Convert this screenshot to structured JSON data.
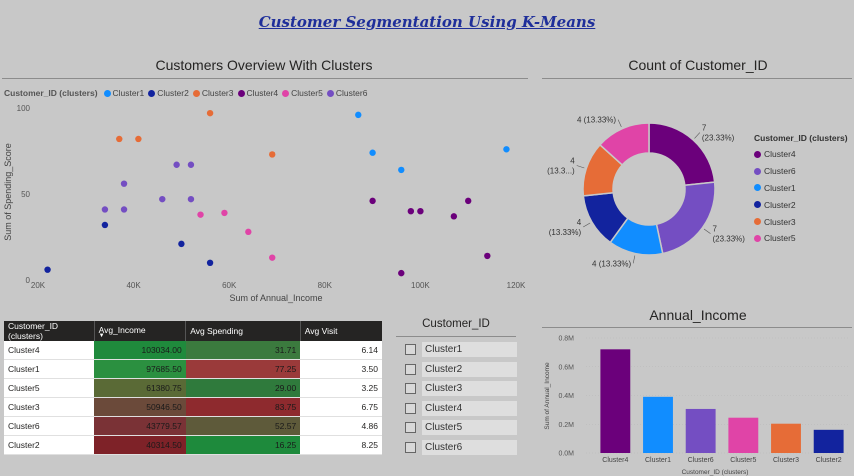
{
  "page": {
    "title": "Customer Segmentation Using K-Means"
  },
  "colors": {
    "Cluster1": "#118dff",
    "Cluster2": "#12239e",
    "Cluster3": "#e66c37",
    "Cluster4": "#6b007b",
    "Cluster5": "#e044a7",
    "Cluster6": "#744ec2"
  },
  "scatter": {
    "title": "Customers Overview With Clusters",
    "legend_title": "Customer_ID (clusters)",
    "legend_items": [
      "Cluster1",
      "Cluster2",
      "Cluster3",
      "Cluster4",
      "Cluster5",
      "Cluster6"
    ],
    "xlabel": "Sum of Annual_Income",
    "ylabel": "Sum of Spending_Score",
    "x_ticks": [
      "20K",
      "40K",
      "60K",
      "80K",
      "100K",
      "120K"
    ],
    "y_ticks": [
      "0",
      "50",
      "100"
    ]
  },
  "donut": {
    "title": "Count of Customer_ID",
    "legend_title": "Customer_ID (clusters)",
    "legend_items": [
      "Cluster4",
      "Cluster6",
      "Cluster1",
      "Cluster2",
      "Cluster3",
      "Cluster5"
    ],
    "labels": [
      "7\n(23.33%)",
      "7\n(23.33%)",
      "4 (13.33%)",
      "4\n(13.33%)",
      "4\n(13.3...)",
      "4 (13.33%)"
    ]
  },
  "table": {
    "headers": [
      "Customer_ID (clusters)",
      "Avg_Income",
      "Avg Spending",
      "Avg Visit"
    ],
    "rows": [
      {
        "cluster": "Cluster4",
        "income": "103034.00",
        "spending": "31.71",
        "visit": "6.14"
      },
      {
        "cluster": "Cluster1",
        "income": "97685.50",
        "spending": "77.25",
        "visit": "3.50"
      },
      {
        "cluster": "Cluster5",
        "income": "61380.75",
        "spending": "29.00",
        "visit": "3.25"
      },
      {
        "cluster": "Cluster3",
        "income": "50946.50",
        "spending": "83.75",
        "visit": "6.75"
      },
      {
        "cluster": "Cluster6",
        "income": "43779.57",
        "spending": "52.57",
        "visit": "4.86"
      },
      {
        "cluster": "Cluster2",
        "income": "40314.50",
        "spending": "16.25",
        "visit": "8.25"
      }
    ]
  },
  "slicer": {
    "title": "Customer_ID",
    "items": [
      "Cluster1",
      "Cluster2",
      "Cluster3",
      "Cluster4",
      "Cluster5",
      "Cluster6"
    ]
  },
  "chart_data": [
    {
      "type": "scatter",
      "title": "Customers Overview With Clusters",
      "xlabel": "Sum of Annual_Income",
      "ylabel": "Sum of Spending_Score",
      "xlim": [
        20000,
        120000
      ],
      "ylim": [
        0,
        100
      ],
      "legend": "top",
      "series": [
        {
          "name": "Cluster1",
          "points": [
            [
              87000,
              96
            ],
            [
              118000,
              76
            ],
            [
              90000,
              74
            ],
            [
              96000,
              64
            ]
          ]
        },
        {
          "name": "Cluster2",
          "points": [
            [
              22000,
              6
            ],
            [
              34000,
              32
            ],
            [
              50000,
              21
            ],
            [
              56000,
              10
            ]
          ]
        },
        {
          "name": "Cluster3",
          "points": [
            [
              37000,
              82
            ],
            [
              41000,
              82
            ],
            [
              56000,
              97
            ],
            [
              69000,
              73
            ]
          ]
        },
        {
          "name": "Cluster4",
          "points": [
            [
              90000,
              46
            ],
            [
              98000,
              40
            ],
            [
              100000,
              40
            ],
            [
              107000,
              37
            ],
            [
              110000,
              46
            ],
            [
              114000,
              14
            ],
            [
              96000,
              4
            ]
          ]
        },
        {
          "name": "Cluster5",
          "points": [
            [
              54000,
              38
            ],
            [
              59000,
              39
            ],
            [
              64000,
              28
            ],
            [
              69000,
              13
            ]
          ]
        },
        {
          "name": "Cluster6",
          "points": [
            [
              34000,
              41
            ],
            [
              38000,
              56
            ],
            [
              38000,
              41
            ],
            [
              46000,
              47
            ],
            [
              49000,
              67
            ],
            [
              52000,
              67
            ],
            [
              52000,
              47
            ]
          ]
        }
      ]
    },
    {
      "type": "pie",
      "title": "Count of Customer_ID",
      "categories": [
        "Cluster4",
        "Cluster6",
        "Cluster1",
        "Cluster2",
        "Cluster3",
        "Cluster5"
      ],
      "values": [
        7,
        7,
        4,
        4,
        4,
        4
      ]
    },
    {
      "type": "bar",
      "title": "Annual_Income",
      "categories": [
        "Cluster4",
        "Cluster1",
        "Cluster6",
        "Cluster5",
        "Cluster3",
        "Cluster2"
      ],
      "values": [
        721238,
        390742,
        306457,
        245523,
        203786,
        161258
      ],
      "xlabel": "Customer_ID (clusters)",
      "ylabel": "Sum of Annual_Income",
      "ylim": [
        0,
        800000
      ],
      "y_ticks": [
        "0.0M",
        "0.2M",
        "0.4M",
        "0.6M",
        "0.8M"
      ]
    }
  ]
}
